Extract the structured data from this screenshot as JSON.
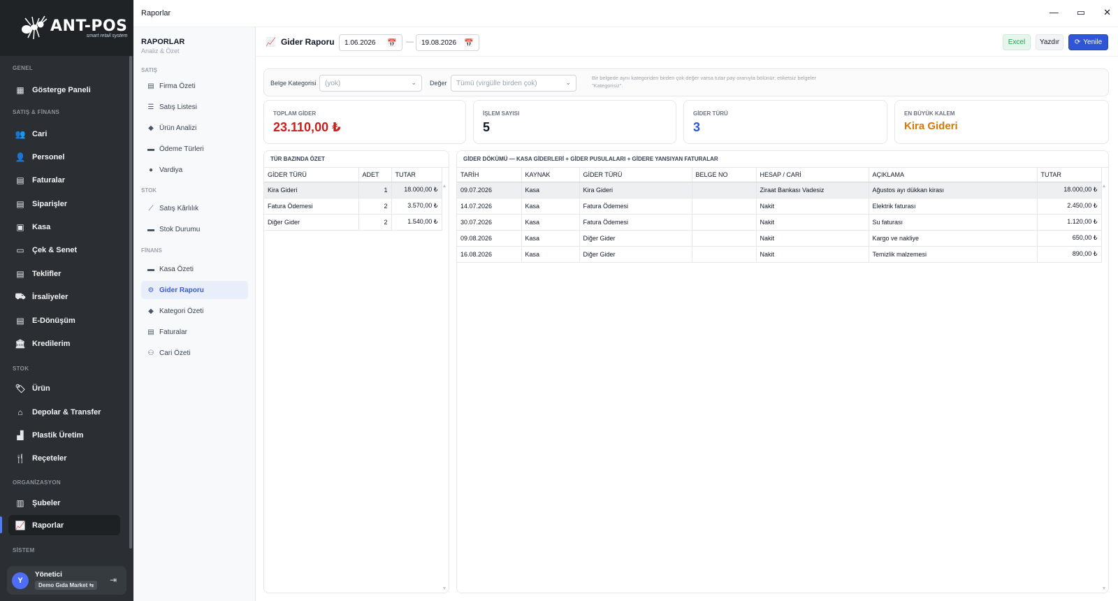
{
  "app": {
    "logo_title": "ANT-POS",
    "logo_sub": "smart retail system",
    "window_title": "Raporlar"
  },
  "sidebar": {
    "groups": {
      "genel": "GENEL",
      "satis_finans": "SATIŞ & FİNANS",
      "stok": "STOK",
      "organizasyon": "ORGANİZASYON",
      "sistem": "SİSTEM"
    },
    "items": [
      {
        "label": "Gösterge Paneli",
        "icon": "dashboard-icon"
      },
      {
        "label": "Cari",
        "icon": "users-icon"
      },
      {
        "label": "Personel",
        "icon": "user-gear-icon"
      },
      {
        "label": "Faturalar",
        "icon": "document-icon"
      },
      {
        "label": "Siparişler",
        "icon": "document-icon"
      },
      {
        "label": "Kasa",
        "icon": "safe-icon"
      },
      {
        "label": "Çek & Senet",
        "icon": "cheque-icon"
      },
      {
        "label": "Teklifler",
        "icon": "document-icon"
      },
      {
        "label": "İrsaliyeler",
        "icon": "truck-icon"
      },
      {
        "label": "E-Dönüşüm",
        "icon": "document-icon"
      },
      {
        "label": "Kredilerim",
        "icon": "bank-icon"
      },
      {
        "label": "Ürün",
        "icon": "tag-icon"
      },
      {
        "label": "Depolar & Transfer",
        "icon": "warehouse-icon"
      },
      {
        "label": "Plastik Üretim",
        "icon": "factory-icon"
      },
      {
        "label": "Reçeteler",
        "icon": "utensils-icon"
      },
      {
        "label": "Şubeler",
        "icon": "building-icon"
      },
      {
        "label": "Raporlar",
        "icon": "chart-line-icon"
      }
    ],
    "user": {
      "avatar_letter": "Y",
      "name": "Yönetici",
      "branch": "Demo Gıda Market ⇆"
    }
  },
  "subnav": {
    "title": "RAPORLAR",
    "subtitle": "Analiz & Özet",
    "groups": {
      "satis": "SATIŞ",
      "stok": "STOK",
      "finans": "FİNANS"
    },
    "items": [
      {
        "label": "Firma Özeti",
        "icon": "document-icon"
      },
      {
        "label": "Satış Listesi",
        "icon": "list-icon"
      },
      {
        "label": "Ürün Analizi",
        "icon": "tag-icon"
      },
      {
        "label": "Ödeme Türleri",
        "icon": "card-icon"
      },
      {
        "label": "Vardiya",
        "icon": "clock-icon"
      },
      {
        "label": "Satış Kârlılık",
        "icon": "chart-line-icon"
      },
      {
        "label": "Stok Durumu",
        "icon": "box-icon"
      },
      {
        "label": "Kasa Özeti",
        "icon": "safe-icon"
      },
      {
        "label": "Gider Raporu",
        "icon": "expense-icon"
      },
      {
        "label": "Kategori Özeti",
        "icon": "tag-icon"
      },
      {
        "label": "Faturalar",
        "icon": "document-icon"
      },
      {
        "label": "Cari Özeti",
        "icon": "users-icon"
      }
    ]
  },
  "report": {
    "title": "Gider Raporu",
    "date_from": "1.06.2026",
    "date_to": "19.08.2026",
    "buttons": {
      "excel": "Excel",
      "print": "Yazdır",
      "refresh": "Yenile"
    }
  },
  "filters": {
    "category_label": "Belge Kategorisi",
    "category_value": "(yok)",
    "value_label": "Değer",
    "value_placeholder": "Tümü (virgülle birden çok)",
    "hint": "Bir belgede aynı kategoriden birden çok değer varsa tutar pay oranıyla bölünür; etiketsiz belgeler \"Kategorisiz\"."
  },
  "kpis": [
    {
      "label": "TOPLAM GİDER",
      "value": "23.110,00 ₺",
      "color": "#c81e1e"
    },
    {
      "label": "İŞLEM SAYISI",
      "value": "5",
      "color": "#111827"
    },
    {
      "label": "GİDER TÜRÜ",
      "value": "3",
      "color": "#2f56d4"
    },
    {
      "label": "EN BÜYÜK KALEM",
      "value": "Kira Gideri",
      "color": "#d97706"
    }
  ],
  "summary": {
    "title": "TÜR BAZINDA ÖZET",
    "columns": [
      "GİDER TÜRÜ",
      "ADET",
      "TUTAR"
    ],
    "rows": [
      [
        "Kira Gideri",
        "1",
        "18.000,00 ₺"
      ],
      [
        "Fatura Ödemesi",
        "2",
        "3.570,00 ₺"
      ],
      [
        "Diğer Gider",
        "2",
        "1.540,00 ₺"
      ]
    ]
  },
  "detail": {
    "title": "GİDER DÖKÜMÜ — KASA GİDERLERİ + GİDER PUSULALARI + GİDERE YANSIYAN FATURALAR",
    "columns": [
      "TARİH",
      "KAYNAK",
      "GİDER TÜRÜ",
      "BELGE NO",
      "HESAP / CARİ",
      "AÇIKLAMA",
      "TUTAR"
    ],
    "rows": [
      [
        "09.07.2026",
        "Kasa",
        "Kira Gideri",
        "",
        "Ziraat Bankası Vadesiz",
        "Ağustos ayı dükkan kirası",
        "18.000,00 ₺"
      ],
      [
        "14.07.2026",
        "Kasa",
        "Fatura Ödemesi",
        "",
        "Nakit",
        "Elektrik faturası",
        "2.450,00 ₺"
      ],
      [
        "30.07.2026",
        "Kasa",
        "Fatura Ödemesi",
        "",
        "Nakit",
        "Su faturası",
        "1.120,00 ₺"
      ],
      [
        "09.08.2026",
        "Kasa",
        "Diğer Gider",
        "",
        "Nakit",
        "Kargo ve nakliye",
        "650,00 ₺"
      ],
      [
        "16.08.2026",
        "Kasa",
        "Diğer Gider",
        "",
        "Nakit",
        "Temizlik malzemesi",
        "890,00 ₺"
      ]
    ]
  }
}
